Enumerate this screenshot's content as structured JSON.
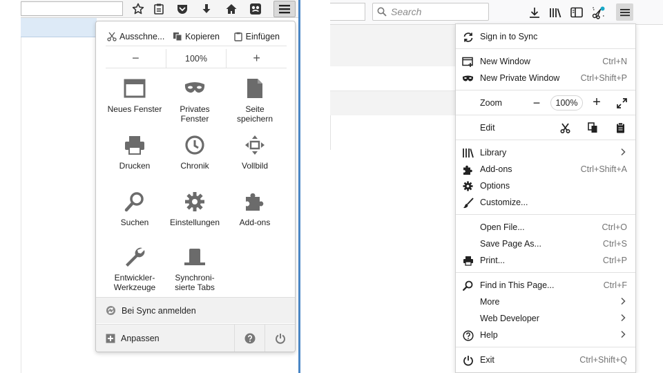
{
  "old_menu": {
    "edit": {
      "cut": "Ausschne...",
      "copy": "Kopieren",
      "paste": "Einfügen"
    },
    "zoom": {
      "minus": "−",
      "level": "100%",
      "plus": "+"
    },
    "grid": [
      {
        "label": "Neues Fenster",
        "icon": "window-icon"
      },
      {
        "label": "Privates\nFenster",
        "icon": "mask-icon"
      },
      {
        "label": "Seite\nspeichern",
        "icon": "page-icon"
      },
      {
        "label": "Drucken",
        "icon": "printer-icon"
      },
      {
        "label": "Chronik",
        "icon": "clock-icon"
      },
      {
        "label": "Vollbild",
        "icon": "fullscreen-icon"
      },
      {
        "label": "Suchen",
        "icon": "search-icon"
      },
      {
        "label": "Einstellungen",
        "icon": "gear-icon"
      },
      {
        "label": "Add-ons",
        "icon": "puzzle-icon"
      },
      {
        "label": "Entwickler-\nWerkzeuge",
        "icon": "wrench-icon"
      },
      {
        "label": "Synchroni-\nsierte Tabs",
        "icon": "synced-tabs-icon"
      }
    ],
    "sync": "Bei Sync anmelden",
    "customize": "Anpassen"
  },
  "new_menu": {
    "search_placeholder": "Search",
    "sign_in": "Sign in to Sync",
    "new_window": {
      "label": "New Window",
      "shortcut": "Ctrl+N"
    },
    "new_private_window": {
      "label": "New Private Window",
      "shortcut": "Ctrl+Shift+P"
    },
    "zoom": {
      "label": "Zoom",
      "minus": "−",
      "level": "100%",
      "plus": "+"
    },
    "edit": {
      "label": "Edit"
    },
    "library": {
      "label": "Library"
    },
    "addons": {
      "label": "Add-ons",
      "shortcut": "Ctrl+Shift+A"
    },
    "options": {
      "label": "Options"
    },
    "customize": {
      "label": "Customize..."
    },
    "open_file": {
      "label": "Open File...",
      "shortcut": "Ctrl+O"
    },
    "save_page": {
      "label": "Save Page As...",
      "shortcut": "Ctrl+S"
    },
    "print": {
      "label": "Print...",
      "shortcut": "Ctrl+P"
    },
    "find": {
      "label": "Find in This Page...",
      "shortcut": "Ctrl+F"
    },
    "more": {
      "label": "More"
    },
    "web_developer": {
      "label": "Web Developer"
    },
    "help": {
      "label": "Help"
    },
    "exit": {
      "label": "Exit",
      "shortcut": "Ctrl+Shift+Q"
    }
  },
  "colors": {
    "icon_grey": "#6b6b6b",
    "accent_blue": "#4a86c5",
    "sync_teal": "#19a9c8"
  }
}
